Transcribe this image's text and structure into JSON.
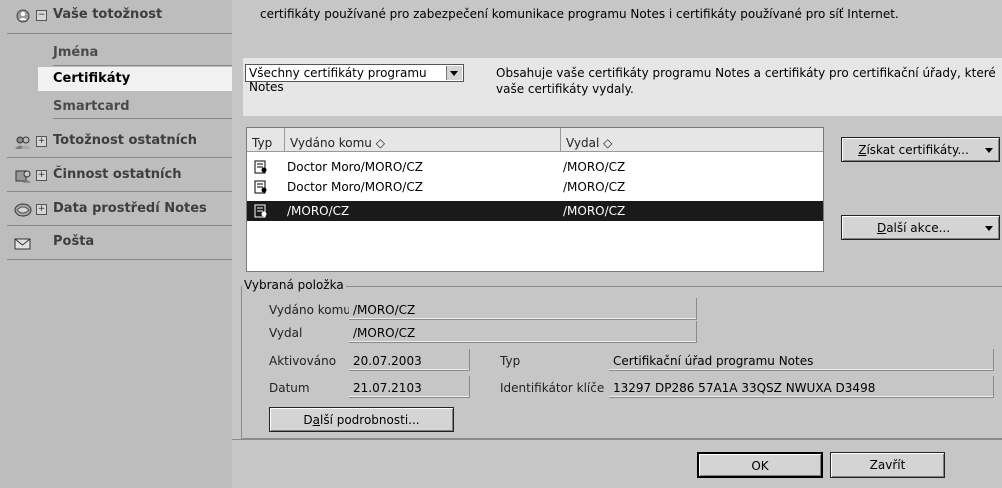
{
  "sidebar": {
    "identity": {
      "label": "Vaše totožnost",
      "toggle": "−"
    },
    "sub_items": [
      {
        "label": "Jména"
      },
      {
        "label": "Certifikáty"
      },
      {
        "label": "Smartcard"
      }
    ],
    "others": {
      "label": "Totožnost ostatních",
      "toggle": "+"
    },
    "activity": {
      "label": "Činnost ostatních",
      "toggle": "+"
    },
    "environment": {
      "label": "Data prostředí Notes",
      "toggle": "+"
    },
    "mail": {
      "label": "Pošta"
    }
  },
  "intro_text": "certifikáty používané pro zabezpečení komunikace programu Notes i certifikáty používané pro síť Internet.",
  "filter": {
    "selected": "Všechny certifikáty programu Notes",
    "description": "Obsahuje vaše certifikáty programu Notes a certifikáty pro certifikační úřady, které vaše certifikáty vydaly."
  },
  "table": {
    "headers": {
      "type": "Typ",
      "issued_to": "Vydáno komu ◇",
      "issuer": "Vydal ◇"
    },
    "rows": [
      {
        "issued_to": "Doctor Moro/MORO/CZ",
        "issuer": "/MORO/CZ"
      },
      {
        "issued_to": "Doctor Moro/MORO/CZ",
        "issuer": "/MORO/CZ"
      },
      {
        "issued_to": "/MORO/CZ",
        "issuer": "/MORO/CZ"
      }
    ]
  },
  "buttons": {
    "get_certs": {
      "pre": "",
      "u": "Z",
      "post": "ískat certifikáty..."
    },
    "more_actions": {
      "pre": "",
      "u": "D",
      "post": "alší akce..."
    },
    "details": {
      "pre": "D",
      "u": "a",
      "post": "lší podrobnosti..."
    },
    "ok": "OK",
    "close": "Zavřít"
  },
  "selected_item": {
    "title": "Vybraná položka",
    "issued_to_label": "Vydáno komu",
    "issued_to": "/MORO/CZ",
    "issuer_label": "Vydal",
    "issuer": "/MORO/CZ",
    "activated_label": "Aktivováno",
    "activated": "20.07.2003",
    "date_label": "Datum",
    "date": "21.07.2103",
    "type_label": "Typ",
    "type": "Certifikační úřad programu Notes",
    "key_id_label": "Identifikátor klíče",
    "key_id": "13297 DP286 57A1A 33QSZ NWUXA D3498"
  }
}
